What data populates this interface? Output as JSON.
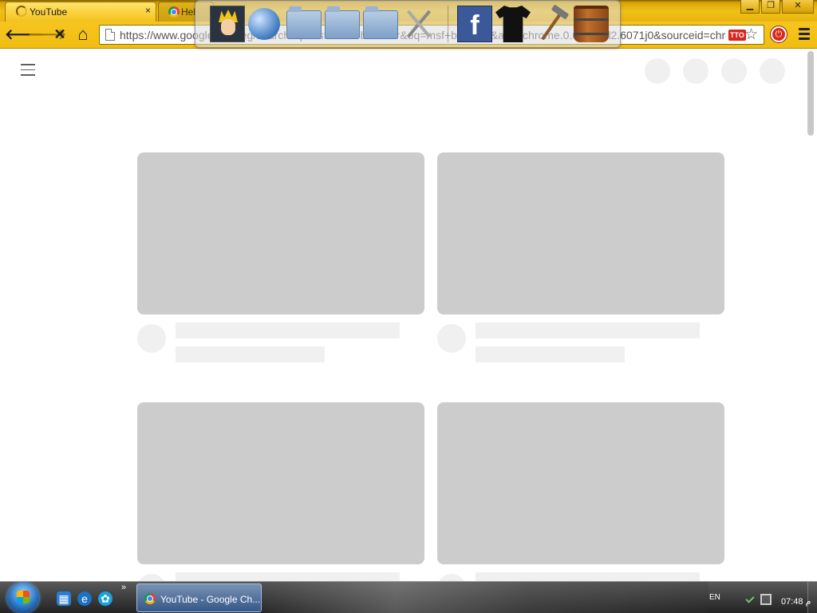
{
  "browser": {
    "tabs": [
      {
        "title": "YouTube",
        "close": "×"
      },
      {
        "title": "Hel"
      }
    ],
    "window_controls": {
      "minimize": "▁",
      "restore": "❐",
      "close": "✕"
    },
    "toolbar": {
      "back": "🡐",
      "forward": "🡒",
      "stop": "✕",
      "home": "⌂"
    },
    "omnibox": {
      "url": "https://www.google.com.eg/search?q=msf+web+browser&oq=msf+browser&aqs=chrome.0.69i57j0l2.6071j0&sourceid=chrome"
    },
    "ext_badge": "TTO",
    "star": "☆",
    "ext_icon": "⏻"
  },
  "dock": {
    "items": [
      "naruto-icon",
      "globe-icon",
      "documents-folder-icon",
      "music-folder-icon",
      "pictures-folder-icon",
      "tools-icon",
      "facebook-icon",
      "shirt-icon",
      "hammer-icon",
      "bucket-icon"
    ],
    "facebook_letter": "f"
  },
  "page": {
    "cards": [
      {
        "name": "video-card-1"
      },
      {
        "name": "video-card-2"
      },
      {
        "name": "video-card-3"
      },
      {
        "name": "video-card-4"
      }
    ]
  },
  "taskbar": {
    "expand": "»",
    "task_label": "YouTube - Google Ch...",
    "language": "EN",
    "clock": "07:48 م"
  },
  "colors": {
    "frame_yellow": "#f1bd12",
    "skeleton_thumb": "#cccccc",
    "skeleton_text": "#f0f0f0"
  }
}
